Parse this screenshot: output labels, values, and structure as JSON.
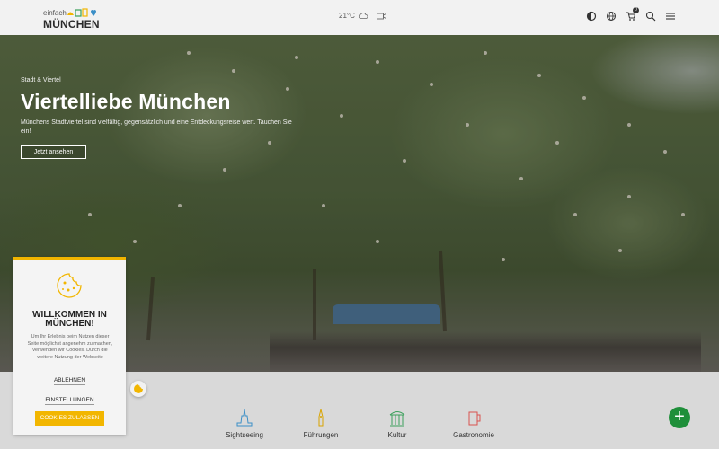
{
  "header": {
    "logo_small": "einfach",
    "logo_big": "MÜNCHEN",
    "weather": "21°C",
    "icons": [
      "contrast-icon",
      "globe-icon",
      "cart-icon",
      "search-icon",
      "menu-icon"
    ],
    "cart_count": "0"
  },
  "hero": {
    "overline": "Stadt & Viertel",
    "title": "Viertelliebe München",
    "description": "Münchens Stadtviertel sind vielfältig, gegensätzlich und eine Entdeckungsreise wert. Tauchen Sie ein!",
    "button": "Jetzt ansehen"
  },
  "categories": [
    {
      "label": "Sightseeing",
      "icon": "sightseeing-icon"
    },
    {
      "label": "Führungen",
      "icon": "fuehrungen-icon"
    },
    {
      "label": "Kultur",
      "icon": "kultur-icon"
    },
    {
      "label": "Gastronomie",
      "icon": "gastronomie-icon"
    }
  ],
  "cookie": {
    "title": "WILLKOMMEN IN MÜNCHEN!",
    "text": "Um Ihr Erlebnis beim Nutzen dieser Seite möglichst angenehm zu machen, verwenden wir Cookies. Durch die weitere Nutzung der Webseite",
    "decline": "ABLEHNEN",
    "settings": "EINSTELLUNGEN",
    "accept": "COOKIES ZULASSEN"
  },
  "colors": {
    "accent": "#f2b600",
    "fab": "#1f8f3a",
    "brand_green": "#3aa05a",
    "brand_blue": "#3b8fc7"
  }
}
